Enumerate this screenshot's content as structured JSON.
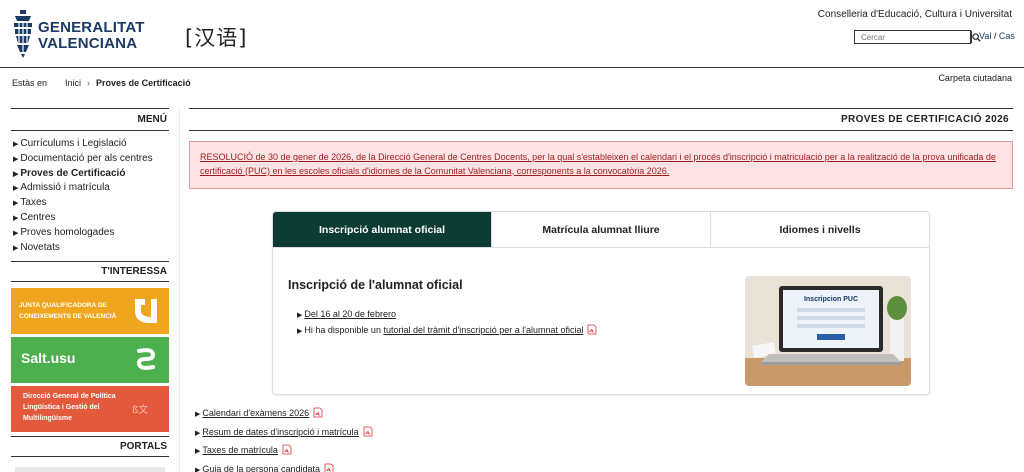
{
  "header": {
    "logo_line1": "GENERALITAT",
    "logo_line2": "VALENCIANA",
    "hanyu_logo": "[汉语]",
    "ministry": "Conselleria d'Educació, Cultura i Universitat",
    "search_placeholder": "Cercar",
    "lang_val": "Val",
    "lang_sep": " / ",
    "lang_cas": "Cas"
  },
  "breadcrumb": {
    "label": "Estàs en",
    "home": "Inici",
    "sep": "›",
    "current": "Proves de Certificació"
  },
  "carpeta": "Carpeta ciutadana",
  "sidebar": {
    "menu_title": "MENÚ",
    "items": [
      {
        "label": "Currículums i Legislació"
      },
      {
        "label": "Documentació per als centres"
      },
      {
        "label": "Proves de Certificació"
      },
      {
        "label": "Admissió i matrícula"
      },
      {
        "label": "Taxes"
      },
      {
        "label": "Centres"
      },
      {
        "label": "Proves homologades"
      },
      {
        "label": "Novetats"
      }
    ],
    "interessa_title": "T'INTERESSA",
    "banner1": "JUNTA QUALIFICADORA DE CONEIXEMENTS DE VALENCIÀ",
    "banner2": "Salt.usu",
    "banner3": "Direcció General de Política Lingüística i Gestió del Multilingüisme",
    "portals_title": "PORTALS"
  },
  "main": {
    "page_title": "PROVES DE CERTIFICACIÓ 2026",
    "alert": "RESOLUCIÓ de 30 de gener de 2026, de la Direcció General de Centres Docents, per la qual s'estableixen el calendari i el procés d'inscripció i matriculació per a la realització de la prova unificada de certificació (PUC) en les escoles oficials d'idiomes de la Comunitat Valenciana, corresponents a la convocatòria 2026.",
    "tabs": [
      {
        "label": "Inscripció alumnat oficial"
      },
      {
        "label": "Matrícula alumnat lliure"
      },
      {
        "label": "Idiomes i nivells"
      }
    ],
    "tab_heading": "Inscripció de l'alumnat oficial",
    "tab_item1": "Del 16 al 20 de febrero",
    "tab_item2_prefix": "Hi ha disponible un ",
    "tab_item2_link": "tutorial del tràmit d'inscripció per a l'alumnat oficial",
    "laptop_screen_title": "Inscripcion PUC",
    "links": [
      {
        "label": "Calendari d'exàmens 2026"
      },
      {
        "label": "Resum de dates d'inscripció i matrícula"
      },
      {
        "label": "Taxes de matrícula"
      },
      {
        "label": "Guia de la persona candidata"
      }
    ]
  },
  "colors": {
    "active_tab": "#0c3b34",
    "alert_bg": "#fde3e3",
    "alert_text": "#9b1d1d",
    "banner_orange": "#f0a51e",
    "banner_green": "#4db04e",
    "banner_red": "#e2593b",
    "brand_blue": "#1b3a63"
  },
  "icons": [
    "gva-logo-icon",
    "search-icon",
    "triangle-bullet-icon",
    "pdf-icon"
  ]
}
